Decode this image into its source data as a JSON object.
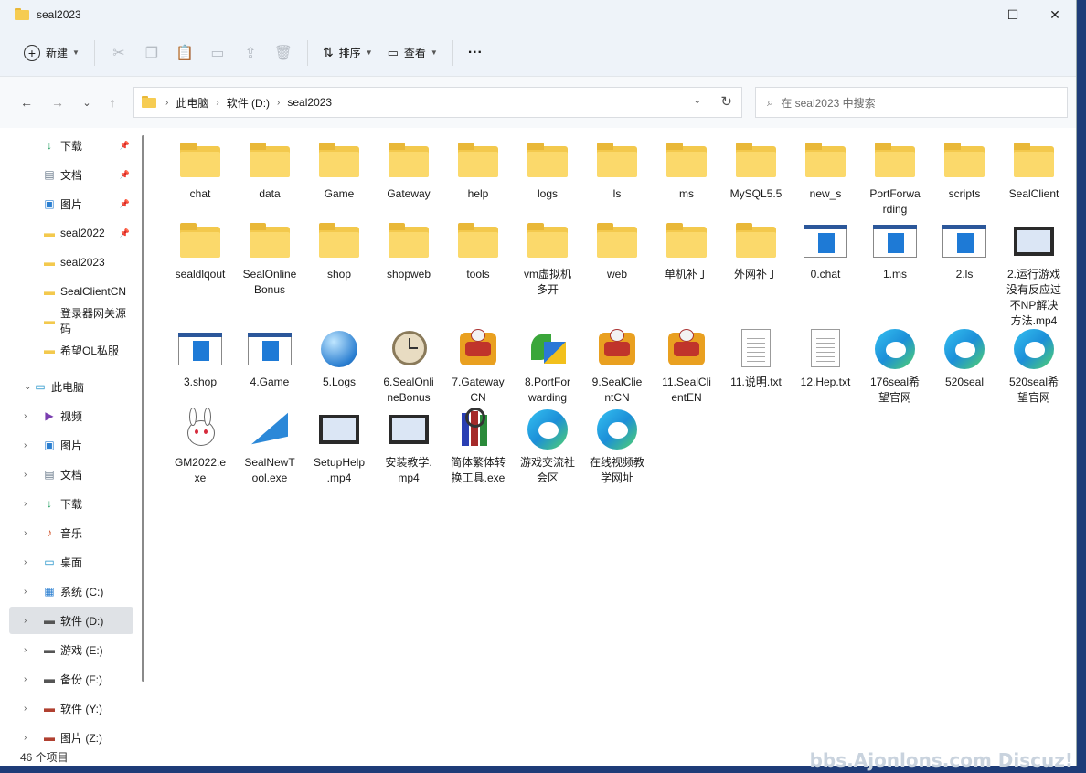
{
  "window": {
    "title": "seal2023",
    "minimize": "—",
    "maximize": "☐",
    "close": "✕"
  },
  "toolbar": {
    "new_label": "新建",
    "sort_label": "排序",
    "view_label": "查看",
    "more_label": "···"
  },
  "nav": {
    "back": "←",
    "forward": "→",
    "recent": "⌄",
    "up": "↑"
  },
  "address": {
    "crumbs": [
      "此电脑",
      "软件 (D:)",
      "seal2023"
    ],
    "dropdown": "⌄",
    "refresh": "↻"
  },
  "search": {
    "placeholder": "在 seal2023 中搜索",
    "icon": "search-icon"
  },
  "sidebar": {
    "quick": [
      {
        "label": "下载",
        "icon": "download-icon",
        "pinned": true
      },
      {
        "label": "文档",
        "icon": "document-icon",
        "pinned": true
      },
      {
        "label": "图片",
        "icon": "pictures-icon",
        "pinned": true
      },
      {
        "label": "seal2022",
        "icon": "folder-icon",
        "pinned": true
      },
      {
        "label": "seal2023",
        "icon": "folder-icon",
        "pinned": false
      },
      {
        "label": "SealClientCN",
        "icon": "folder-icon",
        "pinned": false
      },
      {
        "label": "登录器网关源码",
        "icon": "folder-icon",
        "pinned": false
      },
      {
        "label": "希望OL私服",
        "icon": "folder-icon",
        "pinned": false
      }
    ],
    "this_pc": "此电脑",
    "pc_items": [
      {
        "label": "视频",
        "icon": "video-icon"
      },
      {
        "label": "图片",
        "icon": "pictures-icon"
      },
      {
        "label": "文档",
        "icon": "document-icon"
      },
      {
        "label": "下载",
        "icon": "download-icon"
      },
      {
        "label": "音乐",
        "icon": "music-icon"
      },
      {
        "label": "桌面",
        "icon": "desktop-icon"
      },
      {
        "label": "系统 (C:)",
        "icon": "system-drive-icon"
      },
      {
        "label": "软件 (D:)",
        "icon": "drive-icon",
        "selected": true
      },
      {
        "label": "游戏 (E:)",
        "icon": "drive-icon"
      },
      {
        "label": "备份 (F:)",
        "icon": "drive-icon"
      },
      {
        "label": "软件 (Y:)",
        "icon": "network-drive-icon"
      },
      {
        "label": "图片 (Z:)",
        "icon": "network-drive-icon"
      }
    ]
  },
  "files": [
    {
      "name": "chat",
      "kind": "folder"
    },
    {
      "name": "data",
      "kind": "folder"
    },
    {
      "name": "Game",
      "kind": "folder"
    },
    {
      "name": "Gateway",
      "kind": "folder"
    },
    {
      "name": "help",
      "kind": "folder"
    },
    {
      "name": "logs",
      "kind": "folder"
    },
    {
      "name": "ls",
      "kind": "folder"
    },
    {
      "name": "ms",
      "kind": "folder"
    },
    {
      "name": "MySQL5.5",
      "kind": "folder"
    },
    {
      "name": "new_s",
      "kind": "folder"
    },
    {
      "name": "PortForwa\nrding",
      "kind": "folder"
    },
    {
      "name": "scripts",
      "kind": "folder"
    },
    {
      "name": "SealClient",
      "kind": "folder"
    },
    {
      "name": "sealdlqout",
      "kind": "folder"
    },
    {
      "name": "SealOnline\nBonus",
      "kind": "folder"
    },
    {
      "name": "shop",
      "kind": "folder"
    },
    {
      "name": "shopweb",
      "kind": "folder"
    },
    {
      "name": "tools",
      "kind": "folder"
    },
    {
      "name": "vm虚拟机\n多开",
      "kind": "folder"
    },
    {
      "name": "web",
      "kind": "folder"
    },
    {
      "name": "单机补丁",
      "kind": "folder"
    },
    {
      "name": "外网补丁",
      "kind": "folder"
    },
    {
      "name": "0.chat",
      "kind": "app"
    },
    {
      "name": "1.ms",
      "kind": "app"
    },
    {
      "name": "2.ls",
      "kind": "app"
    },
    {
      "name": "2.运行游戏\n没有反应过\n不NP解决\n方法.mp4",
      "kind": "video"
    },
    {
      "name": "3.shop",
      "kind": "app"
    },
    {
      "name": "4.Game",
      "kind": "app"
    },
    {
      "name": "5.Logs",
      "kind": "globe"
    },
    {
      "name": "6.SealOnli\nneBonus",
      "kind": "clock"
    },
    {
      "name": "7.Gateway\nCN",
      "kind": "game"
    },
    {
      "name": "8.PortFor\nwarding",
      "kind": "leaf"
    },
    {
      "name": "9.SealClie\nntCN",
      "kind": "game"
    },
    {
      "name": "11.SealCli\nentEN",
      "kind": "game"
    },
    {
      "name": "11.说明.txt",
      "kind": "txt",
      "selected": true
    },
    {
      "name": "12.Hep.txt",
      "kind": "txt"
    },
    {
      "name": "176seal希\n望官网",
      "kind": "edge"
    },
    {
      "name": "520seal",
      "kind": "edge"
    },
    {
      "name": "520seal希\n望官网",
      "kind": "edge"
    },
    {
      "name": "GM2022.e\nxe",
      "kind": "rabbit"
    },
    {
      "name": "SealNewT\nool.exe",
      "kind": "plane"
    },
    {
      "name": "SetupHelp\n.mp4",
      "kind": "video"
    },
    {
      "name": "安装教学.\nmp4",
      "kind": "video"
    },
    {
      "name": "简体繁体转\n换工具.exe",
      "kind": "books"
    },
    {
      "name": "游戏交流社\n会区",
      "kind": "edge"
    },
    {
      "name": "在线视频教\n学网址",
      "kind": "edge"
    }
  ],
  "status": {
    "count": "46 个项目"
  },
  "watermark": "bbs.Ajonlons.com  Discuz!"
}
